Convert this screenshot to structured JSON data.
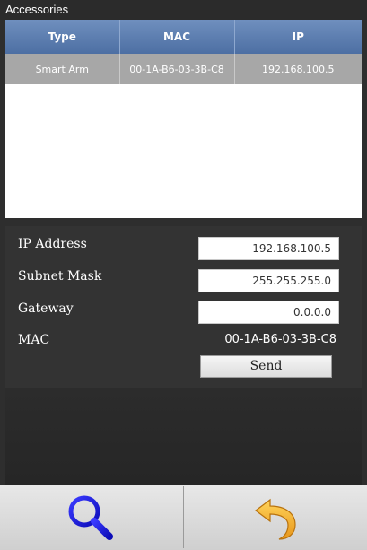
{
  "window": {
    "title": "Accessories"
  },
  "table": {
    "headers": [
      "Type",
      "MAC",
      "IP"
    ],
    "rows": [
      {
        "type": "Smart Arm",
        "mac": "00-1A-B6-03-3B-C8",
        "ip": "192.168.100.5"
      }
    ]
  },
  "settings": {
    "ip_label": "IP Address",
    "ip_value": "192.168.100.5",
    "subnet_label": "Subnet Mask",
    "subnet_value": "255.255.255.0",
    "gateway_label": "Gateway",
    "gateway_value": "0.0.0.0",
    "mac_label": "MAC",
    "mac_value": "00-1A-B6-03-3B-C8",
    "send_label": "Send"
  },
  "toolbar": {
    "search_icon": "search-icon",
    "back_icon": "back-icon",
    "accent_blue": "#1a1ad6",
    "accent_orange": "#f5a623"
  }
}
